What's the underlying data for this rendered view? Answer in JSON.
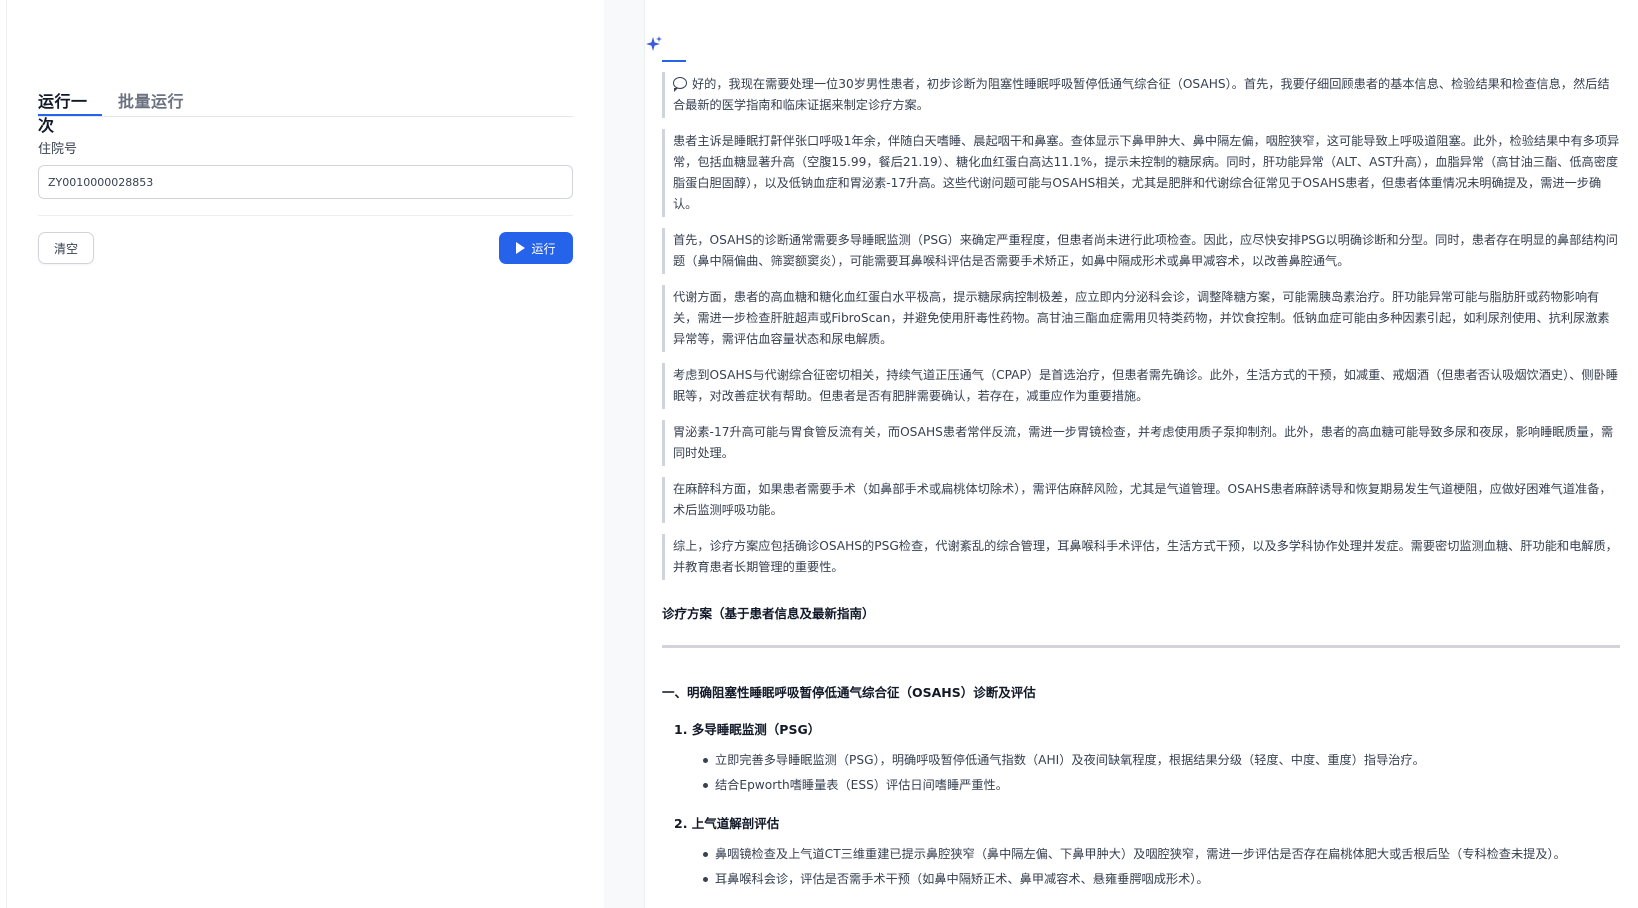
{
  "left": {
    "tabs": [
      {
        "label": "运行一次",
        "active": true
      },
      {
        "label": "批量运行",
        "active": false
      }
    ],
    "field_label": "住院号",
    "input_value": "ZY0010000028853",
    "clear_label": "清空",
    "run_label": "运行"
  },
  "output": {
    "paragraphs": [
      "好的，我现在需要处理一位30岁男性患者，初步诊断为阻塞性睡眠呼吸暂停低通气综合征（OSAHS）。首先，我要仔细回顾患者的基本信息、检验结果和检查信息，然后结合最新的医学指南和临床证据来制定诊疗方案。",
      "患者主诉是睡眠打鼾伴张口呼吸1年余，伴随白天嗜睡、晨起咽干和鼻塞。查体显示下鼻甲肿大、鼻中隔左偏，咽腔狭窄，这可能导致上呼吸道阻塞。此外，检验结果中有多项异常，包括血糖显著升高（空腹15.99，餐后21.19）、糖化血红蛋白高达11.1%，提示未控制的糖尿病。同时，肝功能异常（ALT、AST升高），血脂异常（高甘油三酯、低高密度脂蛋白胆固醇），以及低钠血症和胃泌素-17升高。这些代谢问题可能与OSAHS相关，尤其是肥胖和代谢综合征常见于OSAHS患者，但患者体重情况未明确提及，需进一步确认。",
      "首先，OSAHS的诊断通常需要多导睡眠监测（PSG）来确定严重程度，但患者尚未进行此项检查。因此，应尽快安排PSG以明确诊断和分型。同时，患者存在明显的鼻部结构问题（鼻中隔偏曲、筛窦额窦炎），可能需要耳鼻喉科评估是否需要手术矫正，如鼻中隔成形术或鼻甲减容术，以改善鼻腔通气。",
      "代谢方面，患者的高血糖和糖化血红蛋白水平极高，提示糖尿病控制极差，应立即内分泌科会诊，调整降糖方案，可能需胰岛素治疗。肝功能异常可能与脂肪肝或药物影响有关，需进一步检查肝脏超声或FibroScan，并避免使用肝毒性药物。高甘油三酯血症需用贝特类药物，并饮食控制。低钠血症可能由多种因素引起，如利尿剂使用、抗利尿激素异常等，需评估血容量状态和尿电解质。",
      "考虑到OSAHS与代谢综合征密切相关，持续气道正压通气（CPAP）是首选治疗，但患者需先确诊。此外，生活方式的干预，如减重、戒烟酒（但患者否认吸烟饮酒史）、侧卧睡眠等，对改善症状有帮助。但患者是否有肥胖需要确认，若存在，减重应作为重要措施。",
      "胃泌素-17升高可能与胃食管反流有关，而OSAHS患者常伴反流，需进一步胃镜检查，并考虑使用质子泵抑制剂。此外，患者的高血糖可能导致多尿和夜尿，影响睡眠质量，需同时处理。",
      "在麻醉科方面，如果患者需要手术（如鼻部手术或扁桃体切除术），需评估麻醉风险，尤其是气道管理。OSAHS患者麻醉诱导和恢复期易发生气道梗阻，应做好困难气道准备，术后监测呼吸功能。",
      "综上，诊疗方案应包括确诊OSAHS的PSG检查，代谢紊乱的综合管理，耳鼻喉科手术评估，生活方式干预，以及多学科协作处理并发症。需要密切监测血糖、肝功能和电解质，并教育患者长期管理的重要性。"
    ],
    "plan_title": "诊疗方案（基于患者信息及最新指南）",
    "section_1": "一、明确阻塞性睡眠呼吸暂停低通气综合征（OSAHS）诊断及评估",
    "items": [
      {
        "title": "1. 多导睡眠监测（PSG）",
        "bullets": [
          "立即完善多导睡眠监测（PSG），明确呼吸暂停低通气指数（AHI）及夜间缺氧程度，根据结果分级（轻度、中度、重度）指导治疗。",
          "结合Epworth嗜睡量表（ESS）评估日间嗜睡严重性。"
        ]
      },
      {
        "title": "2. 上气道解剖评估",
        "bullets": [
          "鼻咽镜检查及上气道CT三维重建已提示鼻腔狭窄（鼻中隔左偏、下鼻甲肿大）及咽腔狭窄，需进一步评估是否存在扁桃体肥大或舌根后坠（专科检查未提及）。",
          "耳鼻喉科会诊，评估是否需手术干预（如鼻中隔矫正术、鼻甲减容术、悬雍垂腭咽成形术）。"
        ]
      }
    ]
  }
}
